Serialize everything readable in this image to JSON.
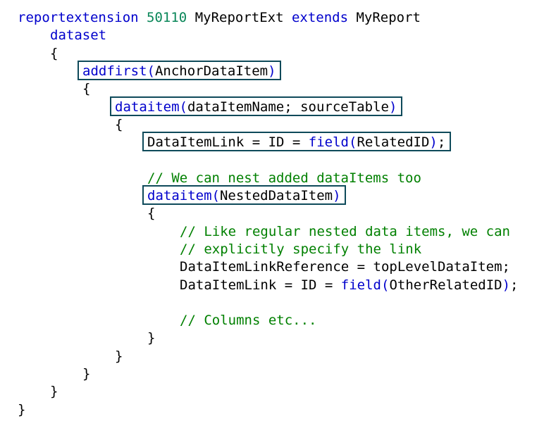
{
  "code_lines": [
    {
      "indent": 0,
      "tokens": [
        {
          "t": "reportextension",
          "c": "kw"
        },
        {
          "t": " "
        },
        {
          "t": "50110",
          "c": "num"
        },
        {
          "t": " MyReportExt "
        },
        {
          "t": "extends",
          "c": "kw"
        },
        {
          "t": " MyReport"
        }
      ]
    },
    {
      "indent": 1,
      "tokens": [
        {
          "t": "dataset",
          "c": "kw"
        }
      ]
    },
    {
      "indent": 1,
      "tokens": [
        {
          "t": "{"
        }
      ]
    },
    {
      "indent": 2,
      "tokens": [
        {
          "t": "addfirst",
          "c": "kw"
        },
        {
          "t": "(",
          "c": "kw"
        },
        {
          "t": "AnchorDataItem"
        },
        {
          "t": ")",
          "c": "kw"
        }
      ]
    },
    {
      "indent": 2,
      "tokens": [
        {
          "t": "{"
        }
      ]
    },
    {
      "indent": 3,
      "tokens": [
        {
          "t": "dataitem",
          "c": "kw"
        },
        {
          "t": "(",
          "c": "kw"
        },
        {
          "t": "dataItemName; sourceTable"
        },
        {
          "t": ")",
          "c": "kw"
        }
      ]
    },
    {
      "indent": 3,
      "tokens": [
        {
          "t": "{"
        }
      ]
    },
    {
      "indent": 4,
      "tokens": [
        {
          "t": "DataItemLink = ID = "
        },
        {
          "t": "field",
          "c": "kw"
        },
        {
          "t": "(",
          "c": "kw"
        },
        {
          "t": "RelatedID"
        },
        {
          "t": ")",
          "c": "kw"
        },
        {
          "t": ";"
        }
      ]
    },
    {
      "indent": 4,
      "tokens": []
    },
    {
      "indent": 4,
      "tokens": [
        {
          "t": "// We can nest added dataItems too",
          "c": "cm"
        }
      ]
    },
    {
      "indent": 4,
      "tokens": [
        {
          "t": "dataitem",
          "c": "kw"
        },
        {
          "t": "(",
          "c": "kw"
        },
        {
          "t": "NestedDataItem"
        },
        {
          "t": ")",
          "c": "kw"
        }
      ]
    },
    {
      "indent": 4,
      "tokens": [
        {
          "t": "{"
        }
      ]
    },
    {
      "indent": 5,
      "tokens": [
        {
          "t": "// Like regular nested data items, we can",
          "c": "cm"
        }
      ]
    },
    {
      "indent": 5,
      "tokens": [
        {
          "t": "// explicitly specify the link",
          "c": "cm"
        }
      ]
    },
    {
      "indent": 5,
      "tokens": [
        {
          "t": "DataItemLinkReference = topLevelDataItem;"
        }
      ]
    },
    {
      "indent": 5,
      "tokens": [
        {
          "t": "DataItemLink = ID = "
        },
        {
          "t": "field",
          "c": "kw"
        },
        {
          "t": "(",
          "c": "kw"
        },
        {
          "t": "OtherRelatedID"
        },
        {
          "t": ")",
          "c": "kw"
        },
        {
          "t": ";"
        }
      ]
    },
    {
      "indent": 5,
      "tokens": []
    },
    {
      "indent": 5,
      "tokens": [
        {
          "t": "// Columns etc...",
          "c": "cm"
        }
      ]
    },
    {
      "indent": 4,
      "tokens": [
        {
          "t": "}"
        }
      ]
    },
    {
      "indent": 3,
      "tokens": [
        {
          "t": "}"
        }
      ]
    },
    {
      "indent": 2,
      "tokens": [
        {
          "t": "}"
        }
      ]
    },
    {
      "indent": 1,
      "tokens": [
        {
          "t": "}"
        }
      ]
    },
    {
      "indent": 0,
      "tokens": [
        {
          "t": "}"
        }
      ]
    }
  ],
  "highlight_boxes": [
    {
      "line_index": 3,
      "label": "addfirst(AnchorDataItem)"
    },
    {
      "line_index": 5,
      "label": "dataitem(dataItemName; sourceTable)"
    },
    {
      "line_index": 7,
      "label": "DataItemLink = ID = field(RelatedID);"
    },
    {
      "line_index": 10,
      "label": "dataitem(NestedDataItem)"
    }
  ],
  "colors": {
    "keyword": "#0000cc",
    "number": "#098658",
    "comment": "#008000",
    "text": "#000000",
    "highlight_border": "#0e4a5a",
    "background": "#ffffff"
  }
}
